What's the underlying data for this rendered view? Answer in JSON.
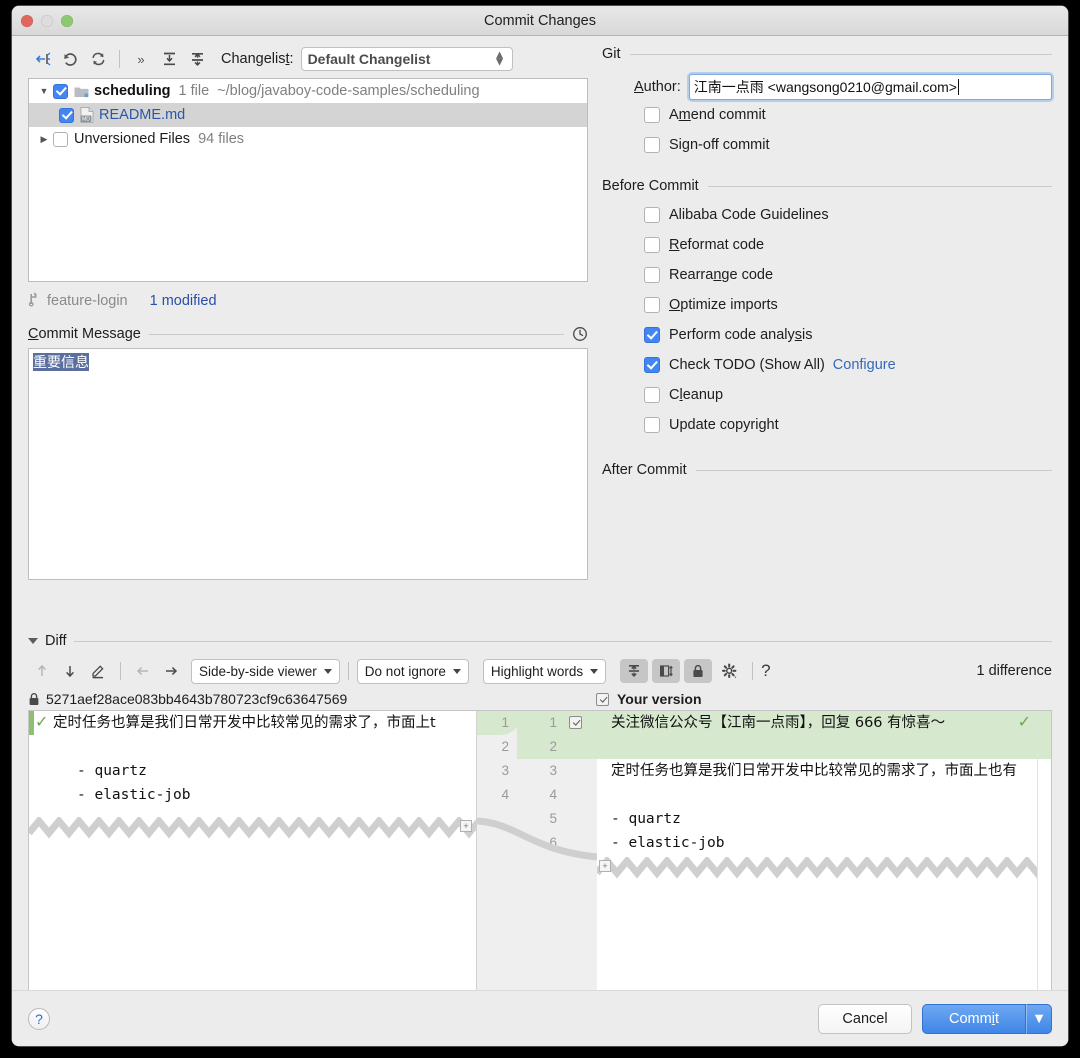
{
  "window": {
    "title": "Commit Changes",
    "traffic_lights": [
      "close-red",
      "minimize-gray",
      "zoom-green"
    ]
  },
  "toolbar": {
    "icons": [
      "move-to-changelist-icon",
      "revert-icon",
      "refresh-icon",
      "expand-more-icon",
      "expand-all-icon",
      "collapse-all-icon"
    ],
    "changelist_label": "Changelist:",
    "changelist_mnemonic": "t",
    "changelist_value": "Default Changelist"
  },
  "file_tree": {
    "rows": [
      {
        "name": "scheduling",
        "count": "1 file",
        "path": "~/blog/javaboy-code-samples/scheduling",
        "checked": true,
        "expanded": true,
        "kind": "folder",
        "selected": false
      },
      {
        "name": "README.md",
        "count": "",
        "path": "",
        "checked": true,
        "expanded": null,
        "kind": "markdown-file",
        "selected": true
      },
      {
        "name": "Unversioned Files",
        "count": "94 files",
        "path": "",
        "checked": false,
        "expanded": false,
        "kind": "group",
        "selected": false
      }
    ]
  },
  "branch_bar": {
    "branch": "feature-login",
    "modified": "1 modified"
  },
  "commit_message": {
    "label": "Commit Message",
    "mnemonic": "C",
    "value": "重要信息",
    "selected": true,
    "history_icon": "clock-history-icon"
  },
  "git": {
    "group_title": "Git",
    "author_label": "Author:",
    "author_mnemonic": "A",
    "author_value": "江南一点雨 <wangsong0210@gmail.com>",
    "options": [
      {
        "label": "Amend commit",
        "mnemonic": "m",
        "checked": false
      },
      {
        "label": "Sign-off commit",
        "mnemonic": "g",
        "checked": false
      }
    ]
  },
  "before_commit": {
    "group_title": "Before Commit",
    "options": [
      {
        "label": "Alibaba Code Guidelines",
        "mnemonic": "",
        "checked": false,
        "link": ""
      },
      {
        "label": "Reformat code",
        "mnemonic": "R",
        "checked": false,
        "link": ""
      },
      {
        "label": "Rearrange code",
        "mnemonic": "n",
        "checked": false,
        "link": ""
      },
      {
        "label": "Optimize imports",
        "mnemonic": "O",
        "checked": false,
        "link": ""
      },
      {
        "label": "Perform code analysis",
        "mnemonic": "s",
        "checked": true,
        "link": ""
      },
      {
        "label": "Check TODO (Show All)",
        "mnemonic": "",
        "checked": true,
        "link": "Configure"
      },
      {
        "label": "Cleanup",
        "mnemonic": "l",
        "checked": false,
        "link": ""
      },
      {
        "label": "Update copyright",
        "mnemonic": "",
        "checked": false,
        "link": ""
      }
    ]
  },
  "after_commit": {
    "group_title": "After Commit"
  },
  "diff": {
    "section_title": "Diff",
    "expanded": true,
    "toolbar_icons": [
      "previous-difference-icon",
      "next-difference-icon",
      "edit-source-icon",
      "accept-left-icon",
      "accept-right-icon"
    ],
    "viewer_mode": "Side-by-side viewer",
    "ignore_mode": "Do not ignore",
    "highlight_mode": "Highlight words",
    "toggle_icons": [
      "collapse-unchanged-icon",
      "whitespace-icon",
      "read-only-lock-icon",
      "settings-gear-icon"
    ],
    "help_icon": "question-mark-icon",
    "difference_count": "1 difference",
    "left_title": "5271aef28ace083bb4643b780723cf9c63647569",
    "left_title_icon": "lock-icon",
    "right_title": "Your version",
    "right_title_checked": true,
    "left_lines": [
      {
        "text": "定时任务也算是我们日常开发中比较常见的需求了，市面上t",
        "cjk": true,
        "accept_mark": true
      },
      {
        "text": "",
        "cjk": false,
        "accept_mark": false
      },
      {
        "text": "- quartz",
        "cjk": false,
        "accept_mark": false
      },
      {
        "text": "- elastic-job",
        "cjk": false,
        "accept_mark": false
      }
    ],
    "left_line_numbers": [
      "1",
      "2",
      "3",
      "4"
    ],
    "right_line_numbers": [
      "1",
      "2",
      "3",
      "4",
      "5",
      "6"
    ],
    "right_lines": [
      {
        "text": "关注微信公众号【江南一点雨】，回复 666 有惊喜～",
        "cjk": true,
        "added": true,
        "checkbox": true
      },
      {
        "text": "",
        "cjk": false,
        "added": true,
        "checkbox": false
      },
      {
        "text": "定时任务也算是我们日常开发中比较常见的需求了，市面上也有",
        "cjk": true,
        "added": false,
        "checkbox": false
      },
      {
        "text": "",
        "cjk": false,
        "added": false,
        "checkbox": false
      },
      {
        "text": "- quartz",
        "cjk": false,
        "added": false,
        "checkbox": false
      },
      {
        "text": "- elastic-job",
        "cjk": false,
        "added": false,
        "checkbox": false
      }
    ]
  },
  "footer": {
    "help_label": "?",
    "cancel_label": "Cancel",
    "commit_label": "Commit",
    "commit_mnemonic": "i",
    "commit_dropdown_icon": "chevron-down-icon"
  },
  "colors": {
    "accent_blue": "#4285f4",
    "link_blue": "#3769b8",
    "added_green": "#d6e8cd",
    "selection_blue": "#5b6f9e",
    "window_bg": "#ececec"
  }
}
